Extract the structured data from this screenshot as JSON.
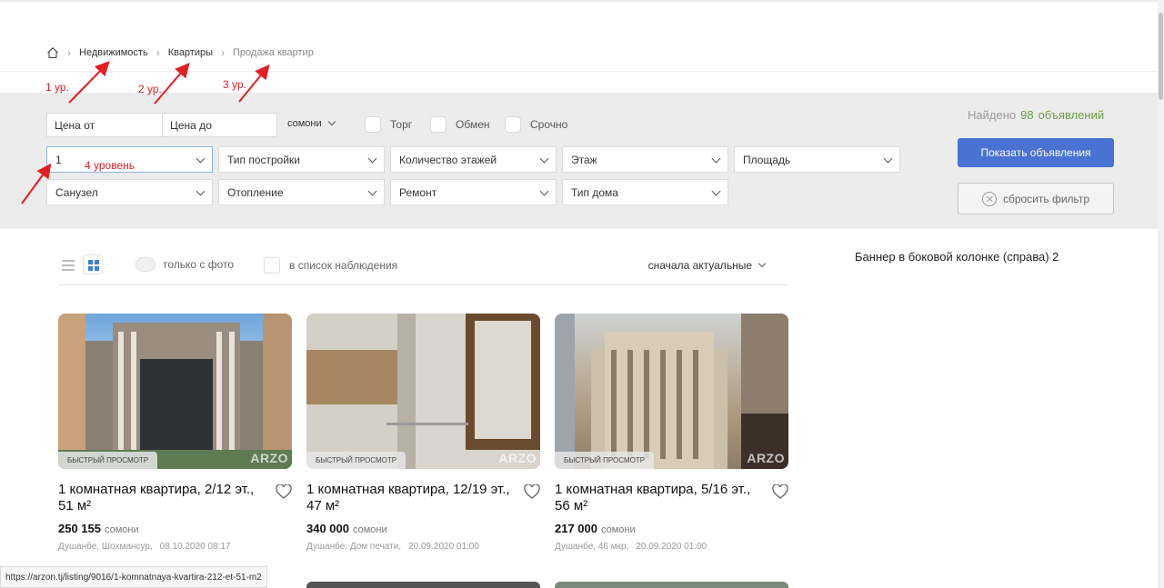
{
  "breadcrumb": {
    "home_icon": "home-icon",
    "items": [
      "Недвижимость",
      "Квартиры",
      "Продажа квартир"
    ]
  },
  "annotations": {
    "level1": "1 ур.",
    "level2": "2 ур.",
    "level3": "3 ур.",
    "level4": "4 уровень",
    "color": "#e31e24"
  },
  "filters": {
    "price_from_placeholder": "Цена от",
    "price_to_placeholder": "Цена до",
    "currency": "сомони",
    "checks": [
      "Торг",
      "Обмен",
      "Срочно"
    ],
    "rooms_value": "1",
    "build_type": "Тип постройки",
    "floors_count": "Количество этажей",
    "floor": "Этаж",
    "area": "Площадь",
    "bathroom": "Санузел",
    "heating": "Отопление",
    "repair": "Ремонт",
    "house_type": "Тип дома"
  },
  "summary": {
    "found_label": "Найдено",
    "found_count": "98",
    "found_word": "объявлений",
    "show_button": "Показать объявления",
    "reset_button": "сбросить фильтр",
    "accent_color": "#4a72d3"
  },
  "toolbar": {
    "only_photo": "только с фото",
    "watchlist": "в список наблюдения",
    "sort": "сначала актуальные"
  },
  "sidebar": {
    "banner": "Баннер в боковой колонке (справа) 2"
  },
  "listings": [
    {
      "quick_view": "БЫСТРЫЙ ПРОСМОТР",
      "watermark": "ARZO",
      "title": "1 комнатная квартира, 2/12 эт., 51 м²",
      "price": "250 155",
      "currency": "сомони",
      "location": "Душанбе, Шохмансур,",
      "date": "08.10.2020 08:17"
    },
    {
      "quick_view": "БЫСТРЫЙ ПРОСМОТР",
      "watermark": "ARZO",
      "title": "1 комнатная квартира, 12/19 эт., 47 м²",
      "price": "340 000",
      "currency": "сомони",
      "location": "Душанбе, Дом печати,",
      "date": "20.09.2020 01:00"
    },
    {
      "quick_view": "БЫСТРЫЙ ПРОСМОТР",
      "watermark": "ARZO",
      "title": "1 комнатная квартира, 5/16 эт., 56 м²",
      "price": "217 000",
      "currency": "сомони",
      "location": "Душанбе, 46 мкр,",
      "date": "20.09.2020 01:00"
    }
  ],
  "status_bar": {
    "url": "https://arzon.tj/listing/9016/1-komnatnaya-kvartira-212-et-51-m2"
  }
}
